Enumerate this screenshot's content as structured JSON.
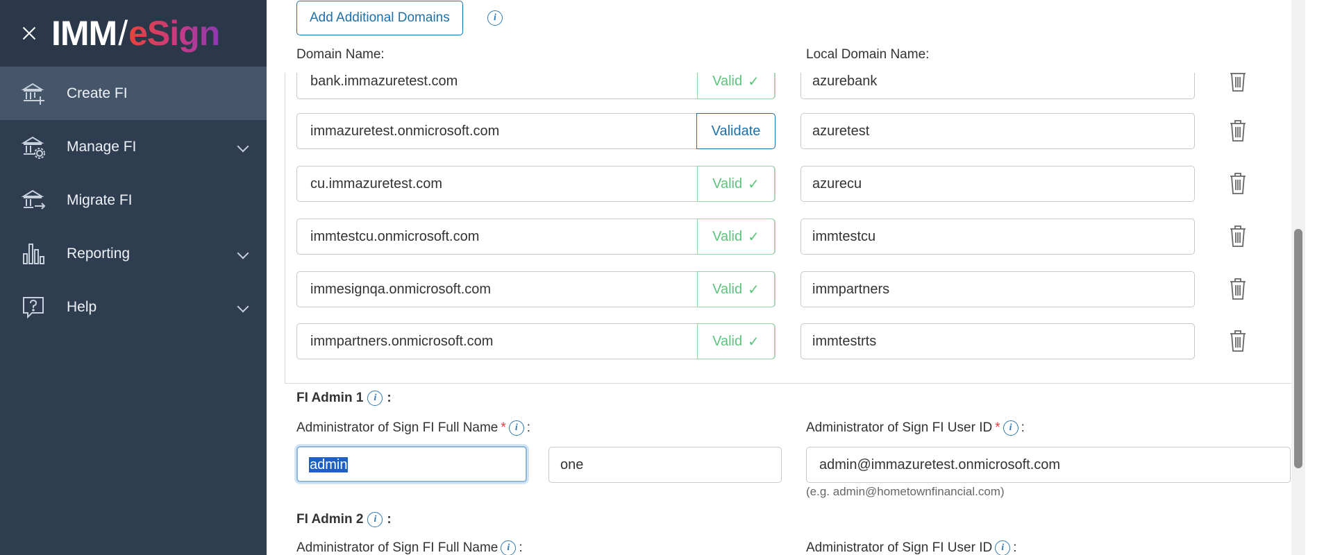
{
  "sidebar": {
    "logo": {
      "imm": "IMM",
      "slash": "/",
      "esign": "eSign"
    },
    "items": [
      {
        "label": "Create FI",
        "icon": "bank-plus-icon",
        "active": true,
        "expandable": false
      },
      {
        "label": "Manage FI",
        "icon": "bank-gear-icon",
        "active": false,
        "expandable": true
      },
      {
        "label": "Migrate FI",
        "icon": "bank-arrow-icon",
        "active": false,
        "expandable": false
      },
      {
        "label": "Reporting",
        "icon": "bar-chart-icon",
        "active": false,
        "expandable": true
      },
      {
        "label": "Help",
        "icon": "question-bubble-icon",
        "active": false,
        "expandable": true
      }
    ]
  },
  "domains": {
    "add_button": "Add Additional Domains",
    "domain_label": "Domain Name:",
    "local_label": "Local Domain Name:",
    "valid_label": "Valid",
    "validate_label": "Validate",
    "rows": [
      {
        "domain": "bank.immazuretest.com",
        "status": "valid",
        "local": "azurebank"
      },
      {
        "domain": "immazuretest.onmicrosoft.com",
        "status": "validate",
        "local": "azuretest"
      },
      {
        "domain": "cu.immazuretest.com",
        "status": "valid",
        "local": "azurecu"
      },
      {
        "domain": "immtestcu.onmicrosoft.com",
        "status": "valid",
        "local": "immtestcu"
      },
      {
        "domain": "immesignqa.onmicrosoft.com",
        "status": "valid",
        "local": "immpartners"
      },
      {
        "domain": "immpartners.onmicrosoft.com",
        "status": "valid",
        "local": "immtestrts"
      }
    ]
  },
  "admin1": {
    "title": "FI Admin 1",
    "colon": ":",
    "fullname_label": "Administrator of Sign FI Full Name",
    "userid_label": "Administrator of Sign FI User ID",
    "first_name": "admin",
    "last_name": "one",
    "user_id": "admin@immazuretest.onmicrosoft.com",
    "hint": "(e.g. admin@hometownfinancial.com)"
  },
  "admin2": {
    "title": "FI Admin 2",
    "colon": ":",
    "fullname_label": "Administrator of Sign FI Full Name",
    "userid_label": "Administrator of Sign FI User ID"
  },
  "colors": {
    "sidebar_bg": "#2f3d51",
    "active_bg": "#45556a",
    "accent": "#1f6fa8",
    "valid": "#5cc47d",
    "required": "#e23a3a"
  }
}
